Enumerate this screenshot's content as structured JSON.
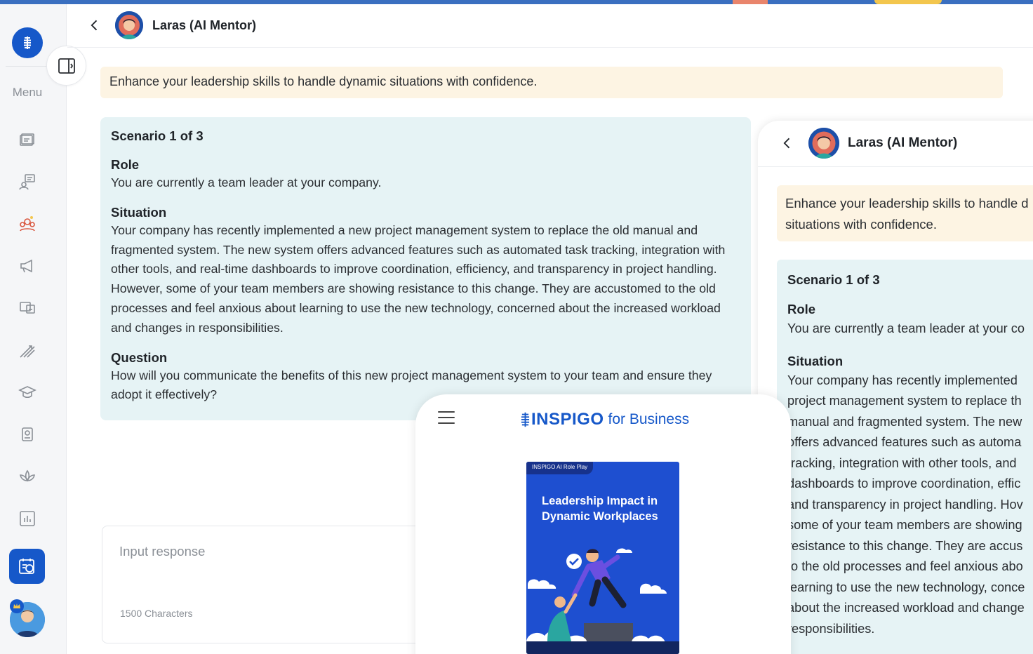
{
  "sidebar": {
    "menu_label": "Menu",
    "icons": [
      "books-icon",
      "chat-certificate-icon",
      "mentor-group-icon",
      "megaphone-icon",
      "presentation-icon",
      "arrows-icon",
      "graduation-icon",
      "badge-icon",
      "lotus-icon",
      "bar-chart-icon"
    ],
    "active_icon": "roleplay-icon"
  },
  "header": {
    "mentor_name": "Laras (AI Mentor)"
  },
  "banner": {
    "text": "Enhance your leadership skills to handle dynamic situations with confidence."
  },
  "scenario": {
    "title": "Scenario 1 of 3",
    "role_title": "Role",
    "role_text": "You are currently a team leader at your company.",
    "situation_title": "Situation",
    "situation_text": "Your company has recently implemented a new project management system to replace the old manual and fragmented system. The new system offers advanced features such as automated task tracking, integration with other tools, and real-time dashboards to improve coordination, efficiency, and transparency in project handling. However, some of your team members are showing resistance to this change. They are accustomed to the old processes and feel anxious about learning to use the new technology, concerned about the increased workload and changes in responsibilities.",
    "question_title": "Question",
    "question_text": "How will you communicate the benefits of this new project management system to your team and ensure they adopt it effectively?"
  },
  "input": {
    "placeholder": "Input response",
    "char_limit": "1500 Characters"
  },
  "right_panel": {
    "mentor_name": "Laras (AI Mentor)",
    "banner_line1": "Enhance your leadership skills to handle d",
    "banner_line2": "situations with confidence.",
    "scenario_title": "Scenario 1 of 3",
    "role_title": "Role",
    "role_text": "You are currently a team leader at your co",
    "situation_title": "Situation",
    "situation_lines": [
      "Your company has recently implemented",
      "project management system to replace th",
      "manual and fragmented system. The new",
      "offers advanced features such as automa",
      "tracking, integration with other tools, and",
      "dashboards to improve coordination, effic",
      "and transparency in project handling. Hov",
      "some of your team members are showing",
      "resistance to this change. They are accus",
      "to the old processes and feel anxious abo",
      "learning to use the new technology, conce",
      "about the increased workload and change",
      "responsibilities."
    ]
  },
  "phone": {
    "brand_main": "INSPIGO",
    "brand_sub": "for Business",
    "cover_tag": "INSPIGO AI Role Play",
    "cover_title": "Leadership Impact in Dynamic Workplaces"
  },
  "colors": {
    "brand_blue": "#1658c9",
    "banner_bg": "#fdf4e3",
    "scenario_bg": "#e6f3f5"
  }
}
